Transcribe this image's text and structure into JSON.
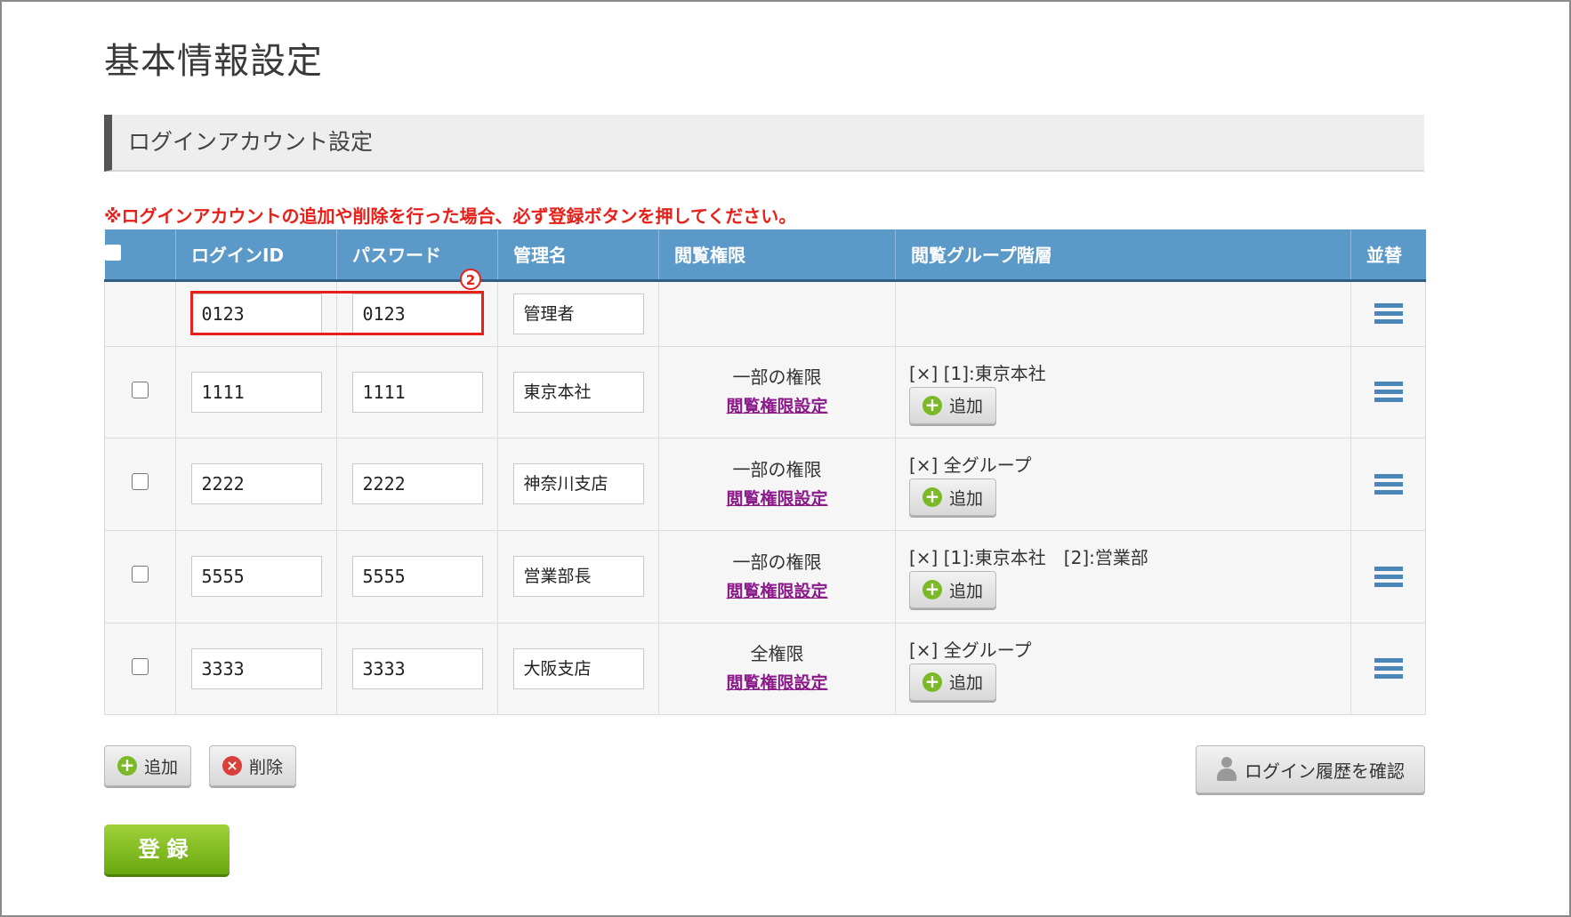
{
  "page_title": "基本情報設定",
  "section_title": "ログインアカウント設定",
  "notice": "※ログインアカウントの追加や削除を行った場合、必ず登録ボタンを押してください。",
  "columns": {
    "login_id": "ログインID",
    "password": "パスワード",
    "admin_name": "管理名",
    "view_permission": "閲覧権限",
    "view_group": "閲覧グループ階層",
    "sort": "並替"
  },
  "badge_number": "2",
  "rows": [
    {
      "login_id": "0123",
      "password": "0123",
      "name": "管理者",
      "permission": "",
      "permission_link": "",
      "groups": "",
      "has_checkbox": false
    },
    {
      "login_id": "1111",
      "password": "1111",
      "name": "東京本社",
      "permission": "一部の権限",
      "permission_link": "閲覧権限設定",
      "groups": "[×] [1]:東京本社",
      "has_checkbox": true
    },
    {
      "login_id": "2222",
      "password": "2222",
      "name": "神奈川支店",
      "permission": "一部の権限",
      "permission_link": "閲覧権限設定",
      "groups": "[×] 全グループ",
      "has_checkbox": true
    },
    {
      "login_id": "5555",
      "password": "5555",
      "name": "営業部長",
      "permission": "一部の権限",
      "permission_link": "閲覧権限設定",
      "groups": "[×] [1]:東京本社　[2]:営業部",
      "has_checkbox": true
    },
    {
      "login_id": "3333",
      "password": "3333",
      "name": "大阪支店",
      "permission": "全権限",
      "permission_link": "閲覧権限設定",
      "groups": "[×] 全グループ",
      "has_checkbox": true
    }
  ],
  "row_add_label": "追加",
  "buttons": {
    "add": "追加",
    "delete": "削除",
    "login_history": "ログイン履歴を確認",
    "submit": "登録"
  },
  "colors": {
    "header_bg": "#5b9ac8",
    "notice_red": "#e8201a",
    "submit_green": "#7cb928",
    "link_purple": "#8b1a8b"
  }
}
